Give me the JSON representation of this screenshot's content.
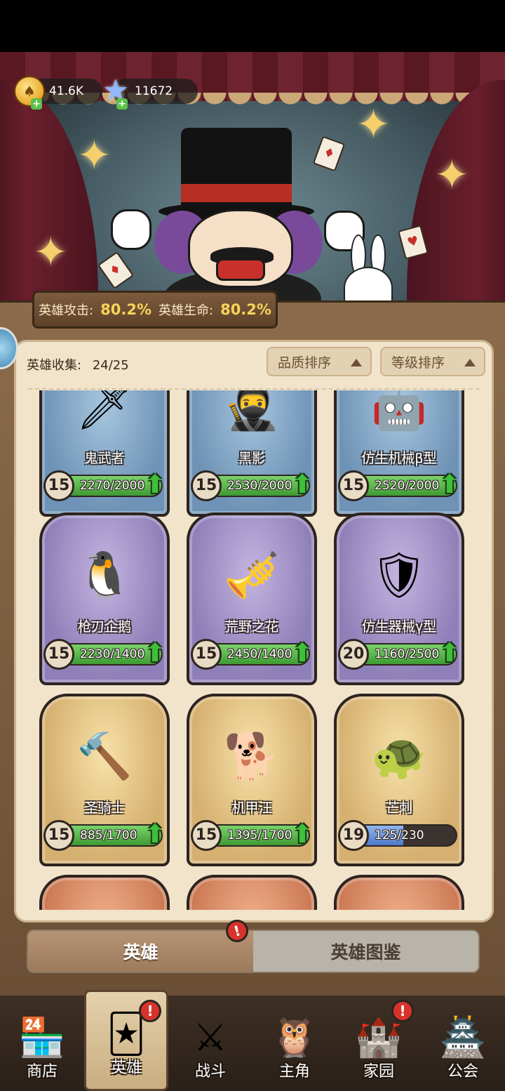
{
  "currency": {
    "gold": "41.6K",
    "gems": "11672"
  },
  "bonus": {
    "attack_label": "英雄攻击:",
    "attack_value": "80.2%",
    "hp_label": "英雄生命:",
    "hp_value": "80.2%"
  },
  "collection": {
    "label": "英雄收集:",
    "count": "24/25"
  },
  "sort": {
    "quality": "品质排序",
    "level": "等级排序"
  },
  "heroes": [
    {
      "name": "鬼武者",
      "level": "15",
      "progress": "2270/2000",
      "quality": "blue",
      "fill": 1.0,
      "icon": "ronin-demon"
    },
    {
      "name": "黑影",
      "level": "15",
      "progress": "2530/2000",
      "quality": "blue",
      "fill": 1.0,
      "icon": "ninja"
    },
    {
      "name": "仿生机械β型",
      "level": "15",
      "progress": "2520/2000",
      "quality": "blue",
      "fill": 1.0,
      "icon": "robot-beta"
    },
    {
      "name": "枪刃企鹅",
      "level": "15",
      "progress": "2230/1400",
      "quality": "purple",
      "fill": 1.0,
      "icon": "knight-penguin"
    },
    {
      "name": "荒野之花",
      "level": "15",
      "progress": "2450/1400",
      "quality": "purple",
      "fill": 1.0,
      "icon": "pirate-girl"
    },
    {
      "name": "仿生器械γ型",
      "level": "20",
      "progress": "1160/2500",
      "quality": "purple",
      "fill": 1.0,
      "icon": "robot-gamma"
    },
    {
      "name": "圣骑士",
      "level": "15",
      "progress": "885/1700",
      "quality": "gold",
      "fill": 1.0,
      "icon": "paladin"
    },
    {
      "name": "机甲汪",
      "level": "15",
      "progress": "1395/1700",
      "quality": "gold",
      "fill": 1.0,
      "icon": "cowboy-dog"
    },
    {
      "name": "芒刺",
      "level": "19",
      "progress": "125/230",
      "quality": "gold",
      "fill": 0.54,
      "icon": "spiky-turtle"
    }
  ],
  "tabs": {
    "heroes": "英雄",
    "codex": "英雄图鉴"
  },
  "nav": [
    {
      "label": "商店",
      "icon": "shop-icon"
    },
    {
      "label": "英雄",
      "icon": "hero-cards-icon"
    },
    {
      "label": "战斗",
      "icon": "battle-icon"
    },
    {
      "label": "主角",
      "icon": "protagonist-icon"
    },
    {
      "label": "家园",
      "icon": "castle-icon"
    },
    {
      "label": "公会",
      "icon": "guild-banner-icon"
    }
  ],
  "alert_mark": "!"
}
